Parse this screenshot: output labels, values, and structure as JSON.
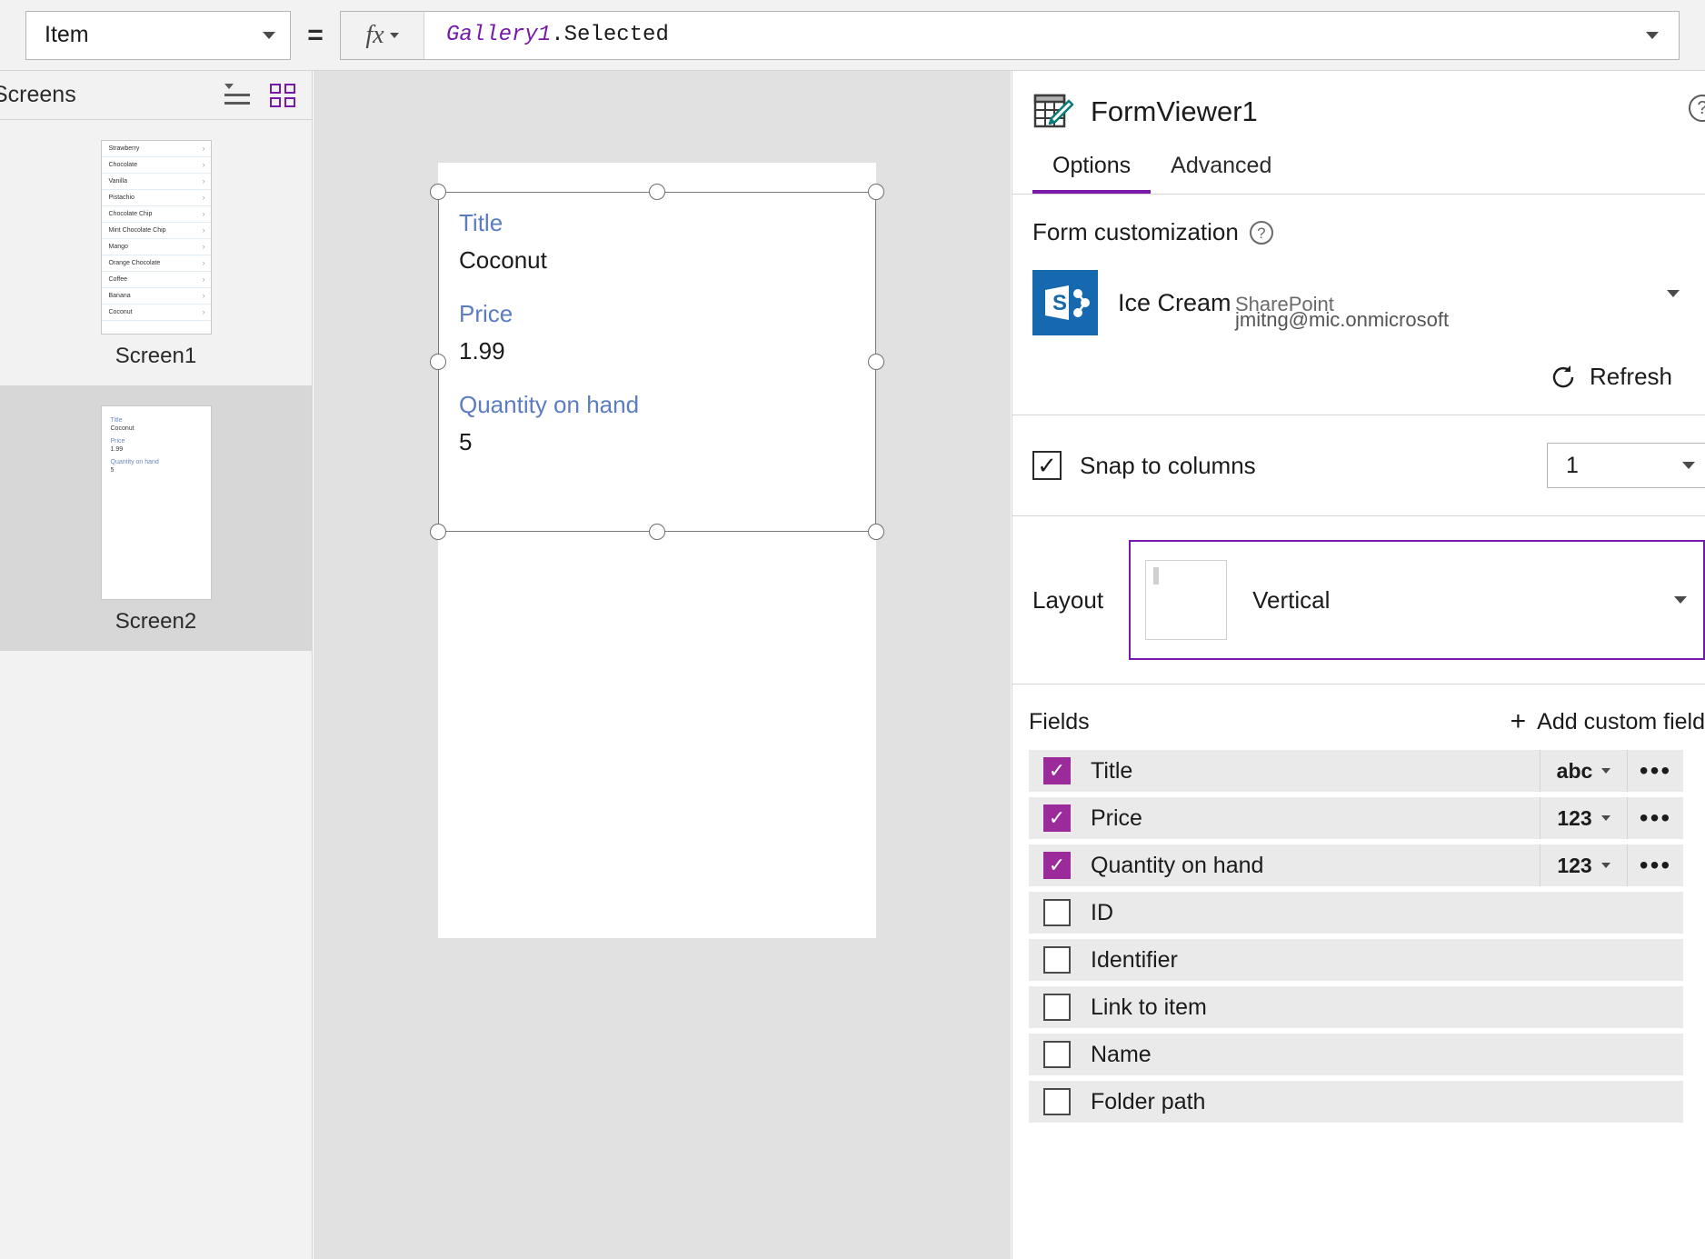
{
  "formula_bar": {
    "property": "Item",
    "equals": "=",
    "fx_label": "fx",
    "formula_identifier": "Gallery1",
    "formula_rest": ".Selected"
  },
  "left_panel": {
    "title": "Screens",
    "screens": [
      {
        "caption": "Screen1",
        "type": "gallery",
        "selected": false,
        "items": [
          "Strawberry",
          "Chocolate",
          "Vanilla",
          "Pistachio",
          "Chocolate Chip",
          "Mint Chocolate Chip",
          "Mango",
          "Orange Chocolate",
          "Coffee",
          "Banana",
          "Coconut"
        ]
      },
      {
        "caption": "Screen2",
        "type": "form",
        "selected": true,
        "fields": [
          {
            "label": "Title",
            "value": "Coconut"
          },
          {
            "label": "Price",
            "value": "1.99"
          },
          {
            "label": "Quantity on hand",
            "value": "5"
          }
        ]
      }
    ]
  },
  "canvas": {
    "form_fields": [
      {
        "label": "Title",
        "value": "Coconut"
      },
      {
        "label": "Price",
        "value": "1.99"
      },
      {
        "label": "Quantity on hand",
        "value": "5"
      }
    ]
  },
  "right_panel": {
    "title": "FormViewer1",
    "help_glyph": "?",
    "tabs": [
      {
        "label": "Options",
        "active": true
      },
      {
        "label": "Advanced",
        "active": false
      }
    ],
    "form_customization": {
      "section_title": "Form customization",
      "help_glyph": "?",
      "data_source": {
        "name": "Ice Cream",
        "account_redacted": "jmitng@mic.onmicrosoft",
        "type": "SharePoint",
        "icon_letter": "S"
      },
      "refresh_label": "Refresh"
    },
    "snap": {
      "checkbox_label": "Snap to columns",
      "checked": true,
      "columns_value": "1"
    },
    "layout": {
      "label": "Layout",
      "value": "Vertical"
    },
    "fields": {
      "title": "Fields",
      "add_label": "Add custom field",
      "rows": [
        {
          "name": "Title",
          "checked": true,
          "type": "abc",
          "has_type": true,
          "has_menu": true
        },
        {
          "name": "Price",
          "checked": true,
          "type": "123",
          "has_type": true,
          "has_menu": true
        },
        {
          "name": "Quantity on hand",
          "checked": true,
          "type": "123",
          "has_type": true,
          "has_menu": true
        },
        {
          "name": "ID",
          "checked": false,
          "type": "",
          "has_type": false,
          "has_menu": false
        },
        {
          "name": "Identifier",
          "checked": false,
          "type": "",
          "has_type": false,
          "has_menu": false
        },
        {
          "name": "Link to item",
          "checked": false,
          "type": "",
          "has_type": false,
          "has_menu": false
        },
        {
          "name": "Name",
          "checked": false,
          "type": "",
          "has_type": false,
          "has_menu": false
        },
        {
          "name": "Folder path",
          "checked": false,
          "type": "",
          "has_type": false,
          "has_menu": false
        }
      ]
    }
  },
  "colors": {
    "accent_purple": "#7719aa",
    "checkbox_purple": "#9b2a9b",
    "sharepoint_blue": "#1769af",
    "field_label_blue": "#5b7cc0"
  }
}
